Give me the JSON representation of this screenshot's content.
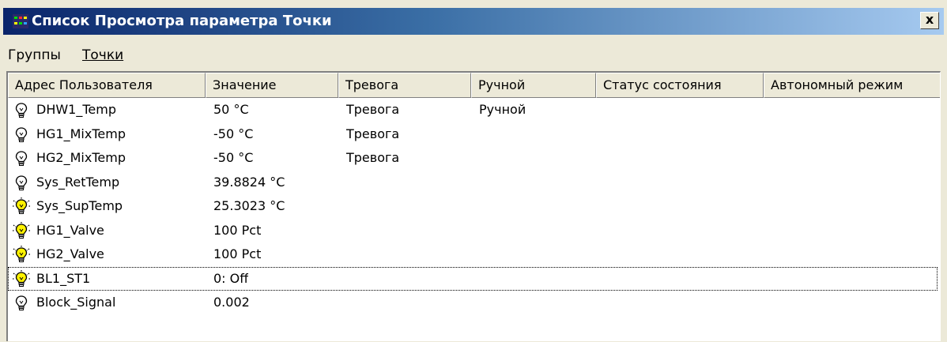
{
  "window": {
    "title": "Список Просмотра параметра Точки",
    "close_label": "x"
  },
  "menu": {
    "items": [
      {
        "label": "Группы"
      },
      {
        "label": "Точки"
      }
    ]
  },
  "table": {
    "columns": [
      "Адрес Пользователя",
      "Значение",
      "Тревога",
      "Ручной",
      "Статус состояния",
      "Автономный режим"
    ],
    "rows": [
      {
        "name": "DHW1_Temp",
        "value": "50 °C",
        "alarm": "Тревога",
        "manual": "Ручной",
        "status": "",
        "offline": "",
        "icon": "bulb-off-icon"
      },
      {
        "name": "HG1_MixTemp",
        "value": "-50 °C",
        "alarm": "Тревога",
        "manual": "",
        "status": "",
        "offline": "",
        "icon": "bulb-off-icon"
      },
      {
        "name": "HG2_MixTemp",
        "value": "-50 °C",
        "alarm": "Тревога",
        "manual": "",
        "status": "",
        "offline": "",
        "icon": "bulb-off-icon"
      },
      {
        "name": "Sys_RetTemp",
        "value": "39.8824 °C",
        "alarm": "",
        "manual": "",
        "status": "",
        "offline": "",
        "icon": "bulb-off-icon"
      },
      {
        "name": "Sys_SupTemp",
        "value": "25.3023 °C",
        "alarm": "",
        "manual": "",
        "status": "",
        "offline": "",
        "icon": "bulb-on-icon"
      },
      {
        "name": "HG1_Valve",
        "value": "100 Pct",
        "alarm": "",
        "manual": "",
        "status": "",
        "offline": "",
        "icon": "bulb-on-icon"
      },
      {
        "name": "HG2_Valve",
        "value": "100 Pct",
        "alarm": "",
        "manual": "",
        "status": "",
        "offline": "",
        "icon": "bulb-on-icon"
      },
      {
        "name": "BL1_ST1",
        "value": "0: Off",
        "alarm": "",
        "manual": "",
        "status": "",
        "offline": "",
        "icon": "bulb-on-icon",
        "focused": true
      },
      {
        "name": "Block_Signal",
        "value": "0.002",
        "alarm": "",
        "manual": "",
        "status": "",
        "offline": "",
        "icon": "bulb-off-icon"
      }
    ]
  },
  "colors": {
    "title_start": "#0a246a",
    "title_end": "#a6caf0",
    "bulb_on": "#fff200"
  }
}
